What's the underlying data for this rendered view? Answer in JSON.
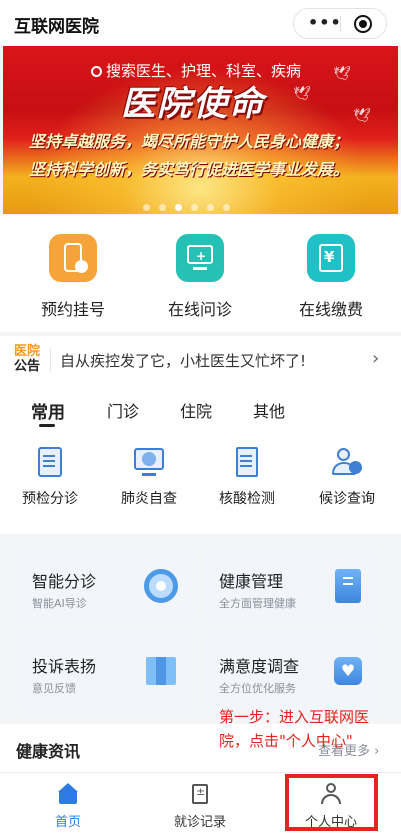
{
  "header": {
    "title": "互联网医院"
  },
  "banner": {
    "search_text": "搜索医生、护理、科室、疾病",
    "headline": "医院使命",
    "line1": "坚持卓越服务，竭尽所能守护人民身心健康；",
    "line2": "坚持科学创新，务实笃行促进医学事业发展。",
    "slide_count": 6,
    "active_slide": 2
  },
  "services": [
    {
      "label": "预约挂号",
      "icon": "appointment-phone-icon"
    },
    {
      "label": "在线问诊",
      "icon": "online-consult-icon"
    },
    {
      "label": "在线缴费",
      "icon": "online-payment-icon"
    }
  ],
  "notice": {
    "tag_top": "医院",
    "tag_bottom": "公告",
    "text": "自从疾控发了它，小杜医生又忙坏了!"
  },
  "tabs": [
    "常用",
    "门诊",
    "住院",
    "其他"
  ],
  "active_tab": 0,
  "sub_services": [
    {
      "label": "预检分诊",
      "icon": "triage-icon"
    },
    {
      "label": "肺炎自查",
      "icon": "pneumonia-check-icon"
    },
    {
      "label": "核酸检测",
      "icon": "nucleic-test-icon"
    },
    {
      "label": "候诊查询",
      "icon": "queue-query-icon"
    }
  ],
  "cards": [
    {
      "title": "智能分诊",
      "subtitle": "智能AI导诊",
      "icon": "ai-triage-icon"
    },
    {
      "title": "健康管理",
      "subtitle": "全方面管理健康",
      "icon": "health-record-icon"
    },
    {
      "title": "投诉表扬",
      "subtitle": "意见反馈",
      "icon": "feedback-map-icon"
    },
    {
      "title": "满意度调查",
      "subtitle": "全方位优化服务",
      "icon": "satisfaction-heart-icon"
    }
  ],
  "news": {
    "title": "健康资讯",
    "more": "查看更多"
  },
  "annotation": "第一步：进入互联网医院，点击\"个人中心\"",
  "tabbar": [
    {
      "label": "首页",
      "active": true
    },
    {
      "label": "就诊记录",
      "active": false
    },
    {
      "label": "个人中心",
      "active": false
    }
  ],
  "colors": {
    "accent": "#2f7be5",
    "annotation": "#e8221e",
    "banner_red": "#d9151a"
  }
}
